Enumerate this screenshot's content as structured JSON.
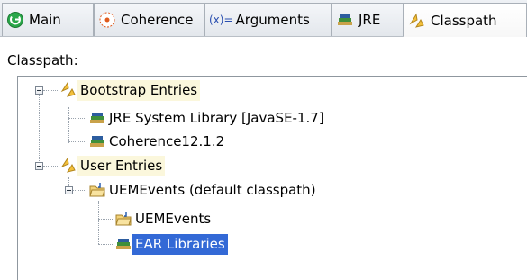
{
  "tabs": [
    {
      "label": "Main",
      "icon": "main-run-icon"
    },
    {
      "label": "Coherence",
      "icon": "coherence-icon"
    },
    {
      "label": "Arguments",
      "icon_text": "(x)=",
      "icon": "arguments-icon"
    },
    {
      "label": "JRE",
      "icon": "jre-library-icon"
    },
    {
      "label": "Classpath",
      "icon": "classpath-icon",
      "active": true
    }
  ],
  "classpath_label": "Classpath:",
  "tree": {
    "bootstrap": {
      "label": "Bootstrap Entries",
      "expanded": true,
      "children": [
        {
          "label": "JRE System Library [JavaSE-1.7]",
          "icon": "library-icon"
        },
        {
          "label": "Coherence12.1.2",
          "icon": "library-icon"
        }
      ]
    },
    "user": {
      "label": "User Entries",
      "expanded": true,
      "children": [
        {
          "label": "UEMEvents (default classpath)",
          "icon": "project-folder-icon",
          "expanded": true,
          "children": [
            {
              "label": "UEMEvents",
              "icon": "project-folder-icon"
            },
            {
              "label": "EAR Libraries",
              "icon": "library-icon",
              "selected": true
            }
          ]
        }
      ]
    }
  },
  "colors": {
    "selection": "#3369d6",
    "category_highlight": "#fbf7dc",
    "main_icon": "#2aa74a"
  }
}
